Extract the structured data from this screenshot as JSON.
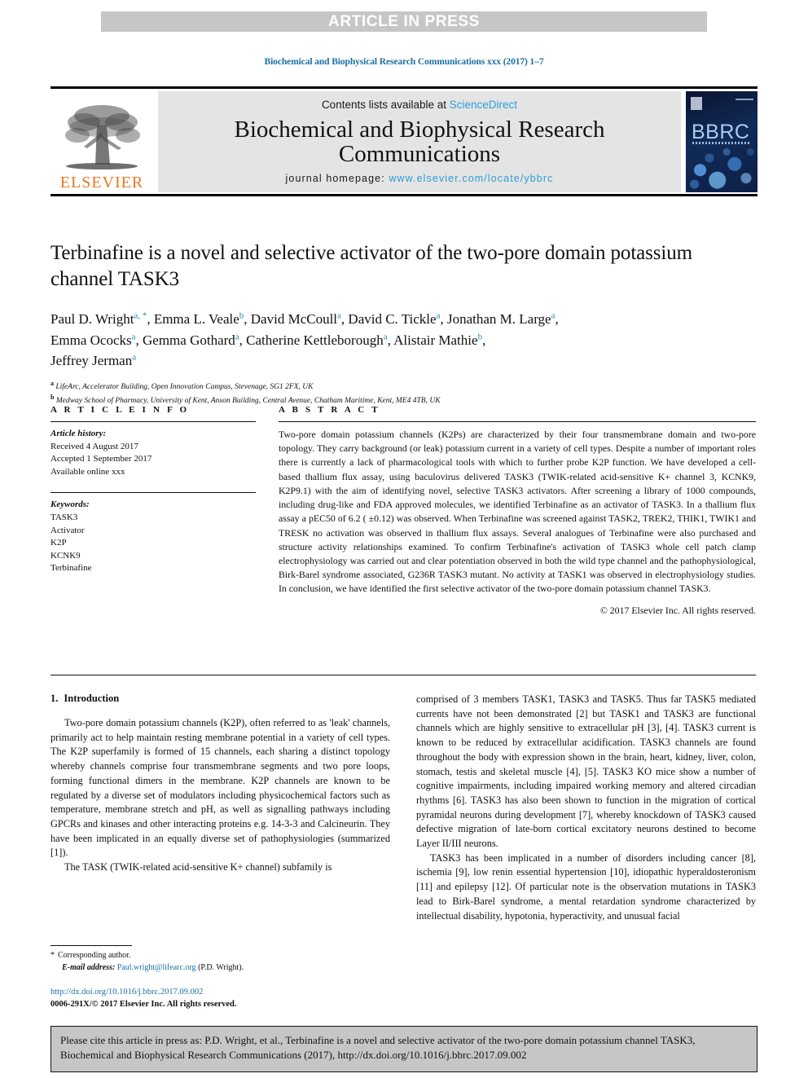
{
  "banner": {
    "text": "ARTICLE IN PRESS",
    "background": "#c6c6c6",
    "text_color": "#ffffff"
  },
  "running_head": {
    "text": "Biochemical and Biophysical Research Communications xxx (2017) 1–7",
    "color": "#1a6fa3"
  },
  "masthead": {
    "contents_prefix": "Contents lists available at ",
    "contents_link": "ScienceDirect",
    "journal_title": "Biochemical and Biophysical Research Communications",
    "homepage_prefix": "journal homepage: ",
    "homepage_url": "www.elsevier.com/locate/ybbrc",
    "publisher_logo_text": "ELSEVIER",
    "publisher_logo_color": "#e87722",
    "cover_text": "BBRC",
    "link_color": "#2a9fd6",
    "panel_background": "#e4e4e4"
  },
  "article": {
    "title": "Terbinafine is a novel and selective activator of the two-pore domain potassium channel TASK3",
    "authors": [
      {
        "name": "Paul D. Wright",
        "marks": "a, *"
      },
      {
        "name": "Emma L. Veale",
        "marks": "b"
      },
      {
        "name": "David McCoull",
        "marks": "a"
      },
      {
        "name": "David C. Tickle",
        "marks": "a"
      },
      {
        "name": "Jonathan M. Large",
        "marks": "a"
      },
      {
        "name": "Emma Ococks",
        "marks": "a"
      },
      {
        "name": "Gemma Gothard",
        "marks": "a"
      },
      {
        "name": "Catherine Kettleborough",
        "marks": "a"
      },
      {
        "name": "Alistair Mathie",
        "marks": "b"
      },
      {
        "name": "Jeffrey Jerman",
        "marks": "a"
      }
    ],
    "authors_line1": "Paul D. Wright a, *, Emma L. Veale b, David McCoull a, David C. Tickle a, Jonathan M. Large a,",
    "authors_line2": "Emma Ococks a, Gemma Gothard a, Catherine Kettleborough a, Alistair Mathie b,",
    "authors_line3": "Jeffrey Jerman a",
    "affiliations": [
      {
        "mark": "a",
        "text": "LifeArc, Accelerator Building, Open Innovation Campus, Stevenage, SG1 2FX, UK"
      },
      {
        "mark": "b",
        "text": "Medway School of Pharmacy, University of Kent, Anson Building, Central Avenue, Chatham Maritime, Kent, ME4 4TB, UK"
      }
    ]
  },
  "article_info": {
    "heading": "A R T I C L E   I N F O",
    "history_label": "Article history:",
    "history": [
      "Received 4 August 2017",
      "Accepted 1 September 2017",
      "Available online xxx"
    ],
    "keywords_label": "Keywords:",
    "keywords": [
      "TASK3",
      "Activator",
      "K2P",
      "KCNK9",
      "Terbinafine"
    ]
  },
  "abstract": {
    "heading": "A B S T R A C T",
    "text": "Two-pore domain potassium channels (K2Ps) are characterized by their four transmembrane domain and two-pore topology. They carry background (or leak) potassium current in a variety of cell types. Despite a number of important roles there is currently a lack of pharmacological tools with which to further probe K2P function. We have developed a cell-based thallium flux assay, using baculovirus delivered TASK3 (TWIK-related acid-sensitive K+ channel 3, KCNK9, K2P9.1) with the aim of identifying novel, selective TASK3 activators. After screening a library of 1000 compounds, including drug-like and FDA approved molecules, we identified Terbinafine as an activator of TASK3. In a thallium flux assay a pEC50 of 6.2 ( ±0.12) was observed. When Terbinafine was screened against TASK2, TREK2, THIK1, TWIK1 and TRESK no activation was observed in thallium flux assays. Several analogues of Terbinafine were also purchased and structure activity relationships examined. To confirm Terbinafine's activation of TASK3 whole cell patch clamp electrophysiology was carried out and clear potentiation observed in both the wild type channel and the pathophysiological, Birk-Barel syndrome associated, G236R TASK3 mutant. No activity at TASK1 was observed in electrophysiology studies. In conclusion, we have identified the first selective activator of the two-pore domain potassium channel TASK3.",
    "copyright": "© 2017 Elsevier Inc. All rights reserved."
  },
  "introduction": {
    "number": "1.",
    "heading": "Introduction",
    "left_paragraph_1": "Two-pore domain potassium channels (K2P), often referred to as 'leak' channels, primarily act to help maintain resting membrane potential in a variety of cell types. The K2P superfamily is formed of 15 channels, each sharing a distinct topology whereby channels comprise four transmembrane segments and two pore loops, forming functional dimers in the membrane. K2P channels are known to be regulated by a diverse set of modulators including physicochemical factors such as temperature, membrane stretch and pH, as well as signalling pathways including GPCRs and kinases and other interacting proteins e.g. 14-3-3 and Calcineurin. They have been implicated in an equally diverse set of pathophysiologies (summarized [1]).",
    "left_paragraph_2": "The TASK (TWIK-related acid-sensitive K+ channel) subfamily is",
    "right_paragraph_1": "comprised of 3 members TASK1, TASK3 and TASK5. Thus far TASK5 mediated currents have not been demonstrated [2] but TASK1 and TASK3 are functional channels which are highly sensitive to extracellular pH [3], [4]. TASK3 current is known to be reduced by extracellular acidification. TASK3 channels are found throughout the body with expression shown in the brain, heart, kidney, liver, colon, stomach, testis and skeletal muscle [4], [5]. TASK3 KO mice show a number of cognitive impairments, including impaired working memory and altered circadian rhythms [6]. TASK3 has also been shown to function in the migration of cortical pyramidal neurons during development [7], whereby knockdown of TASK3 caused defective migration of late-born cortical excitatory neurons destined to become Layer II/III neurons.",
    "right_paragraph_2": "TASK3 has been implicated in a number of disorders including cancer [8], ischemia [9], low renin essential hypertension [10], idiopathic hyperaldosteronism [11] and epilepsy [12]. Of particular note is the observation mutations in TASK3 lead to Birk-Barel syndrome, a mental retardation syndrome characterized by intellectual disability, hypotonia, hyperactivity, and unusual facial"
  },
  "footnotes": {
    "corresponding_star": "*",
    "corresponding_text": "Corresponding author.",
    "email_label": "E-mail address:",
    "email": "Paul.wright@lifearc.org",
    "email_suffix": "(P.D. Wright)."
  },
  "doi_block": {
    "doi_url": "http://dx.doi.org/10.1016/j.bbrc.2017.09.002",
    "issn_line": "0006-291X/© 2017 Elsevier Inc. All rights reserved."
  },
  "citation_box": {
    "text": "Please cite this article in press as: P.D. Wright, et al., Terbinafine is a novel and selective activator of the two-pore domain potassium channel TASK3, Biochemical and Biophysical Research Communications (2017), http://dx.doi.org/10.1016/j.bbrc.2017.09.002",
    "background": "#c6c6c6"
  }
}
